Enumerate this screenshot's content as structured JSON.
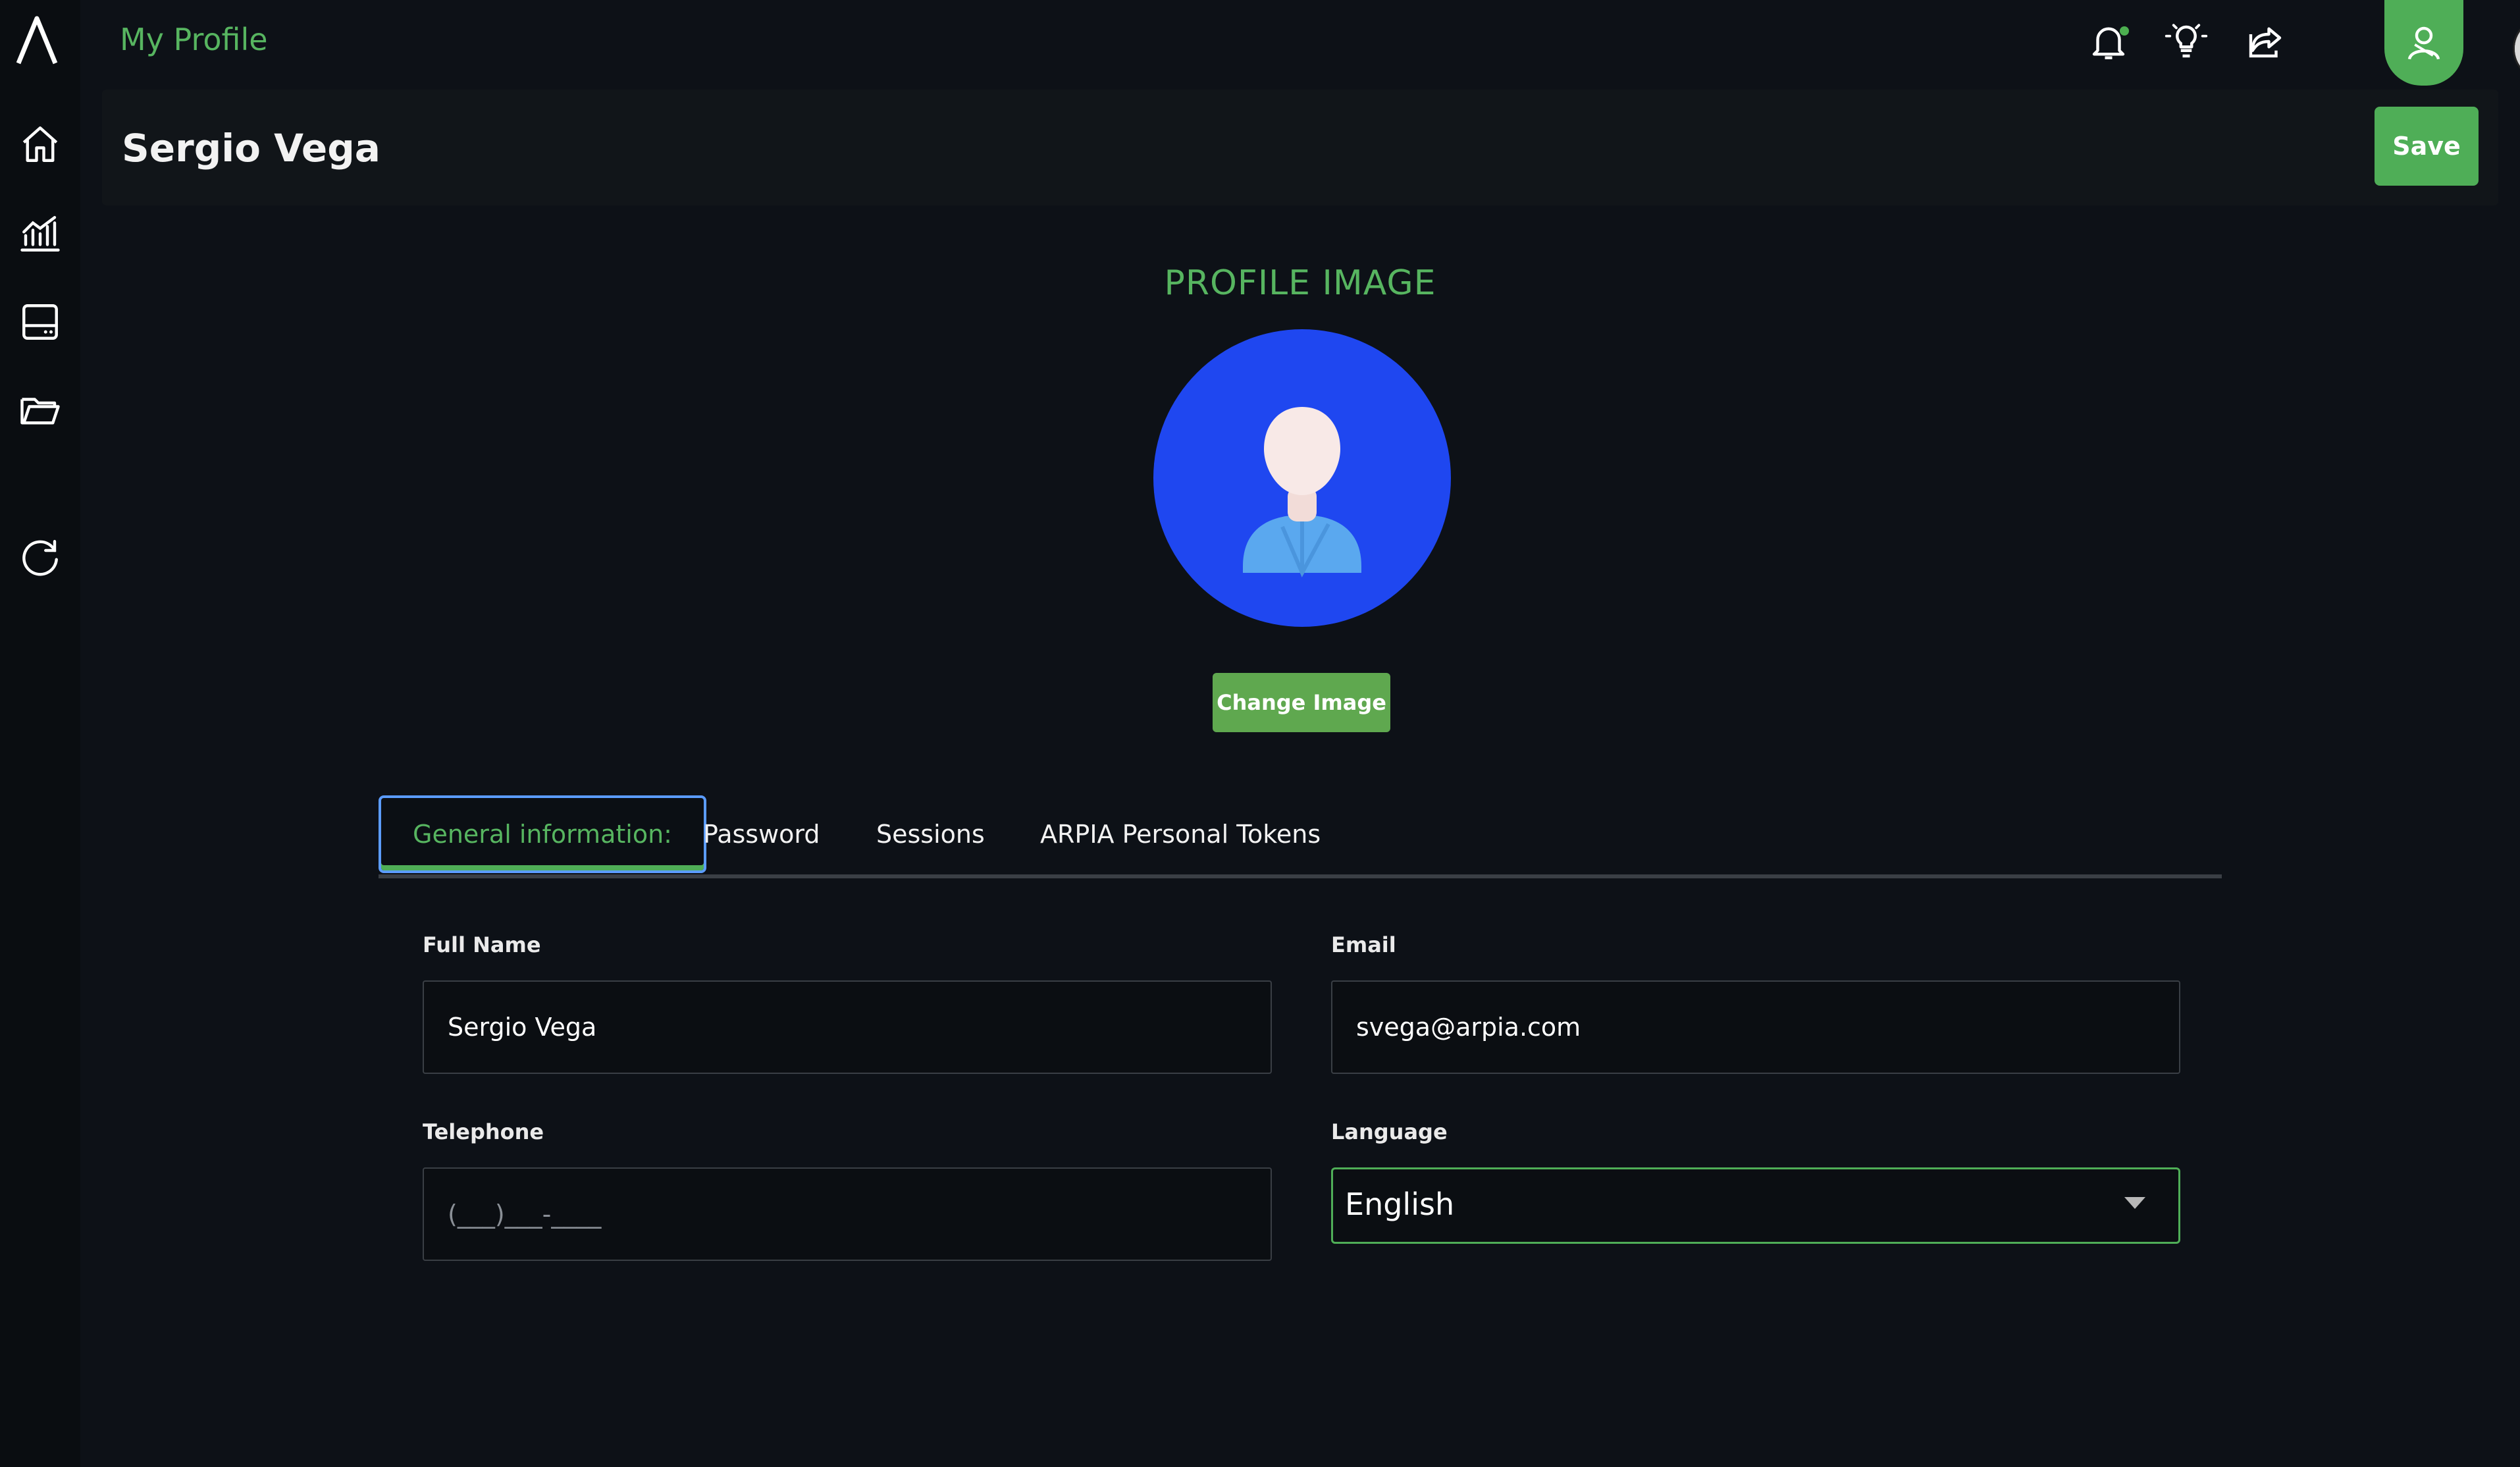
{
  "app": {
    "title": "My Profile"
  },
  "sidebar": {
    "items": [
      {
        "icon": "home-icon"
      },
      {
        "icon": "analytics-icon"
      },
      {
        "icon": "storage-icon"
      },
      {
        "icon": "folder-icon"
      },
      {
        "icon": "refresh-icon"
      }
    ]
  },
  "topbar": {
    "icons": [
      "bell-icon",
      "lightbulb-icon",
      "share-icon",
      "user-icon"
    ]
  },
  "header": {
    "name": "Sergio Vega",
    "save_label": "Save"
  },
  "profile": {
    "section_title": "PROFILE IMAGE",
    "change_image_label": "Change Image"
  },
  "tabs": [
    {
      "label": "General information:",
      "active": true
    },
    {
      "label": "Password",
      "active": false
    },
    {
      "label": "Sessions",
      "active": false
    },
    {
      "label": "ARPIA Personal Tokens",
      "active": false
    }
  ],
  "form": {
    "full_name": {
      "label": "Full Name",
      "value": "Sergio Vega"
    },
    "email": {
      "label": "Email",
      "value": "svega@arpia.com"
    },
    "telephone": {
      "label": "Telephone",
      "value": "",
      "placeholder": "(___)___-____"
    },
    "language": {
      "label": "Language",
      "value": "English"
    }
  },
  "colors": {
    "accent": "#4fae57",
    "background": "#0d1117",
    "avatar_bg": "#1f47f0",
    "active_tab_border": "#5b9cff"
  }
}
